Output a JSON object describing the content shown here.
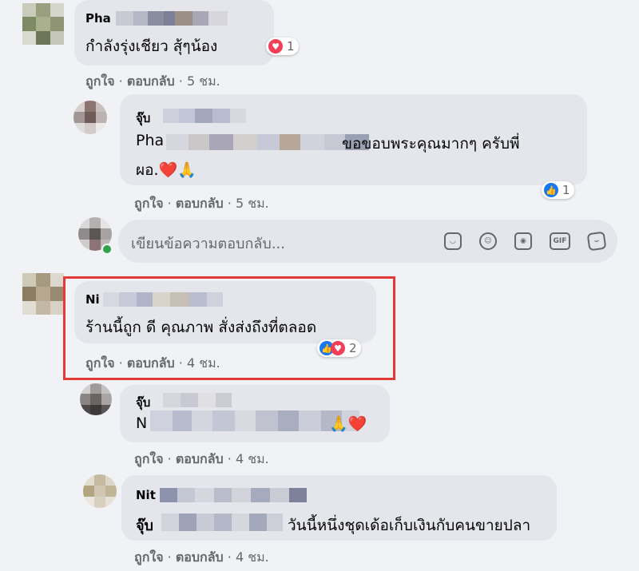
{
  "comments": [
    {
      "name": "Pha",
      "text": "กำลังรุ่งเชียว สุ้ๆน้อง",
      "reaction_count": "1",
      "actions": {
        "like": "ถูกใจ",
        "reply": "ตอบกลับ",
        "time": "5 ชม."
      }
    },
    {
      "name": "จุ๊บ",
      "line1_prefix": "Pha",
      "line1_suffix": "ขอขอบพระคุณมากๆ ครับพี่",
      "line2": "ผอ.❤️🙏",
      "reaction_count": "1",
      "actions": {
        "like": "ถูกใจ",
        "reply": "ตอบกลับ",
        "time": "5 ชม."
      }
    },
    {
      "name": "Ni",
      "text": "ร้านนี้ถูก ดี คุณภาพ สั่งส่งถึงที่ตลอด",
      "reaction_count": "2",
      "actions": {
        "like": "ถูกใจ",
        "reply": "ตอบกลับ",
        "time": "4 ชม."
      }
    },
    {
      "name": "จุ๊บ",
      "line1_prefix": "N",
      "line1_suffix": "🙏❤️",
      "actions": {
        "like": "ถูกใจ",
        "reply": "ตอบกลับ",
        "time": "4 ชม."
      }
    },
    {
      "name": "Nit",
      "line1_prefix": "จุ๊บ",
      "line1_suffix": "วันนี้หนึ่งชุดเด้อเก็บเงินกับคนขายปลา",
      "actions": {
        "like": "ถูกใจ",
        "reply": "ตอบกลับ",
        "time": "4 ชม."
      }
    }
  ],
  "reply_box": {
    "placeholder": "เขียนข้อความตอบกลับ...",
    "tools": [
      "sticker-icon",
      "emoji-icon",
      "camera-icon",
      "gif-icon",
      "sticker-alt-icon"
    ],
    "gif_label": "GIF"
  },
  "colors": {
    "highlight": "#e53935",
    "heart": "#f33e58",
    "like": "#1877f2"
  },
  "dot": "·"
}
